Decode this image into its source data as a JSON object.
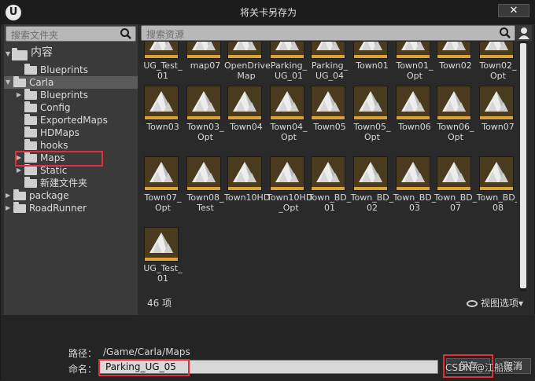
{
  "window": {
    "title": "将关卡另存为",
    "logo": "U",
    "close_symbol": "✕"
  },
  "folder_search": {
    "placeholder": "搜索文件夹"
  },
  "asset_search": {
    "placeholder": "搜索资源"
  },
  "tree": [
    {
      "label": "内容",
      "arrow": "▼",
      "open": true
    },
    {
      "label": "Blueprints",
      "arrow": ""
    },
    {
      "label": "Carla",
      "arrow": "▼",
      "open": true
    },
    {
      "label": "Blueprints",
      "arrow": "▶"
    },
    {
      "label": "Config",
      "arrow": ""
    },
    {
      "label": "ExportedMaps",
      "arrow": ""
    },
    {
      "label": "HDMaps",
      "arrow": ""
    },
    {
      "label": "hooks",
      "arrow": ""
    },
    {
      "label": "Maps",
      "arrow": "▶",
      "selected": true
    },
    {
      "label": "Static",
      "arrow": "▶"
    },
    {
      "label": "新建文件夹",
      "arrow": ""
    },
    {
      "label": "package",
      "arrow": "▶"
    },
    {
      "label": "RoadRunner",
      "arrow": "▶"
    }
  ],
  "assets": [
    "UG_Test_\n01",
    "map07",
    "OpenDrive\nMap",
    "Parking_\nUG_01",
    "Parking_\nUG_04",
    "Town01",
    "Town01_\nOpt",
    "Town02",
    "Town02_\nOpt",
    "Town03",
    "Town03_\nOpt",
    "Town04",
    "Town04_\nOpt",
    "Town05",
    "Town05_\nOpt",
    "Town06",
    "Town06_\nOpt",
    "Town07",
    "Town07_\nOpt",
    "Town08_\nTest",
    "Town10HD",
    "Town10HD\n_Opt",
    "Town_BD_\n01",
    "Town_BD_\n02",
    "Town_BD_\n03",
    "Town_BD_\n07",
    "Town_BD_\n08",
    "UG_Test_\n01"
  ],
  "status": {
    "count": "46 项",
    "view_options": "视图选项",
    "view_caret": "▾"
  },
  "path": {
    "label": "路径：",
    "value": "/Game/Carla/Maps"
  },
  "name": {
    "label": "命名：",
    "value": "Parking_UG_05"
  },
  "buttons": {
    "save": "保存",
    "cancel": "取消"
  },
  "watermark": "CSDN @江船渡",
  "colors": {
    "accent_highlight": "#e0303a",
    "thumb_base": "#d9a23d",
    "thumb_bg": "#4a3a1e"
  }
}
